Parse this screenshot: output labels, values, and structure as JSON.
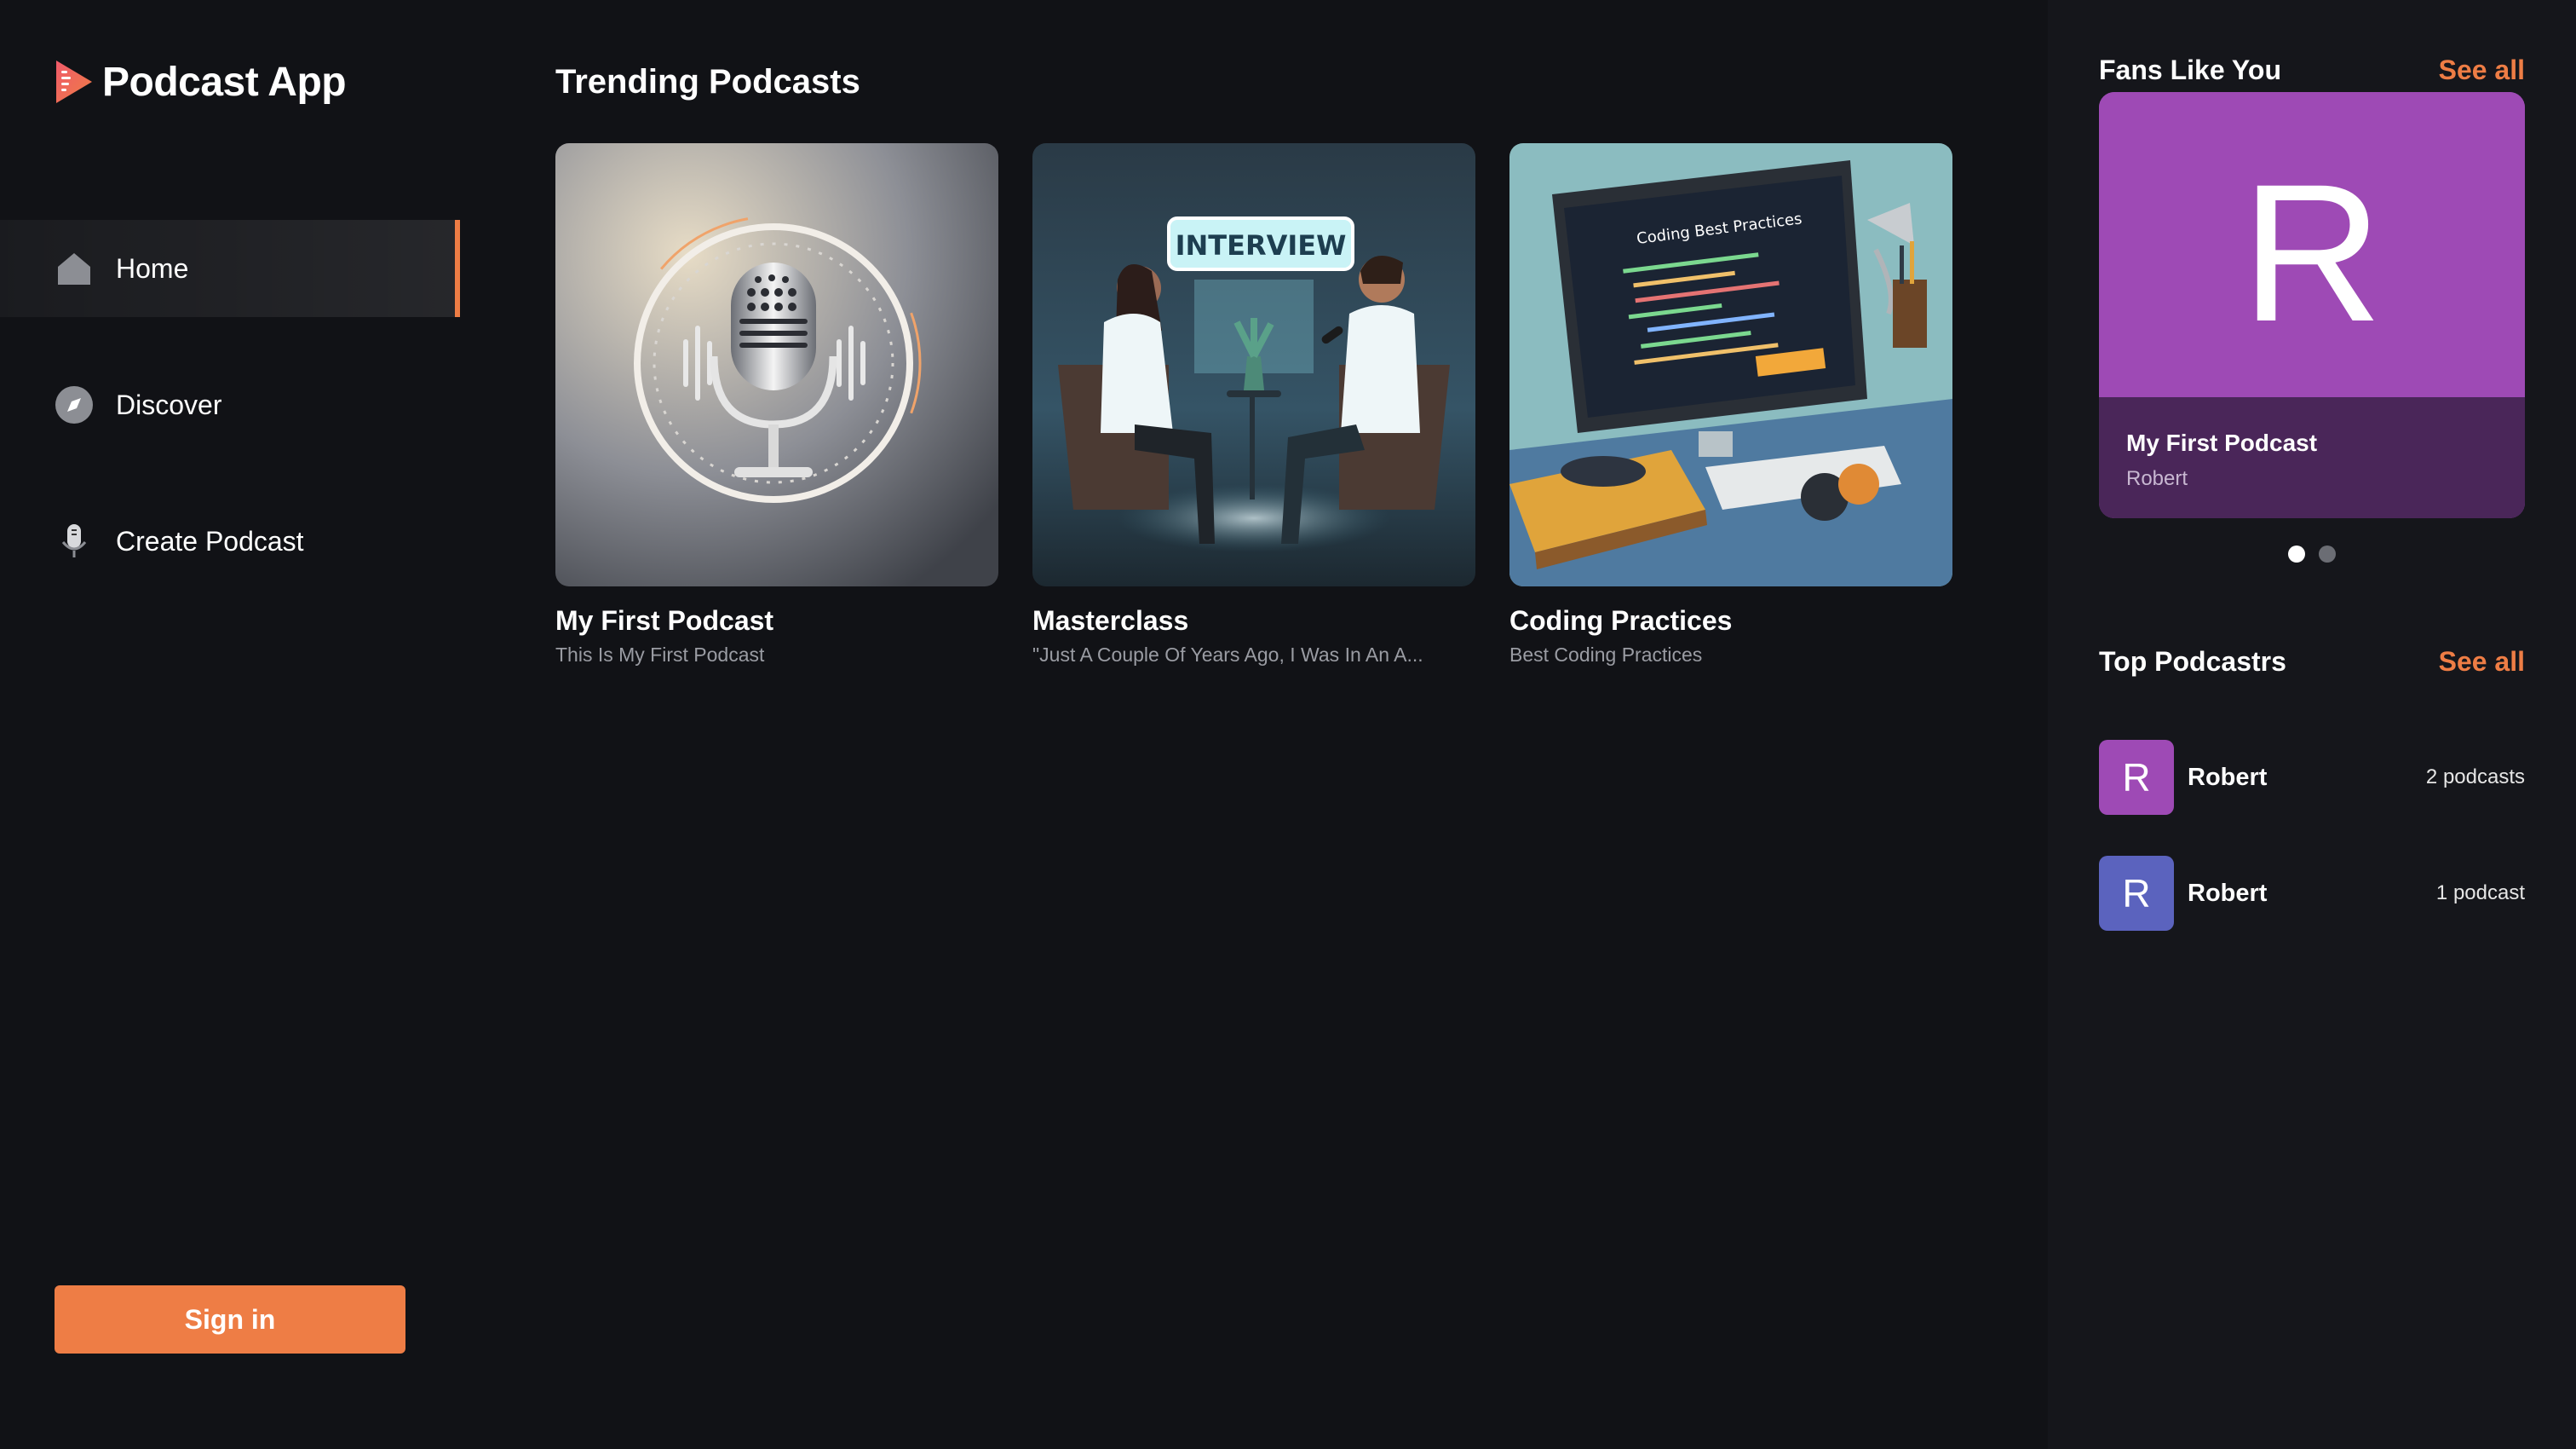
{
  "app": {
    "name": "Podcast App"
  },
  "sidebar": {
    "items": [
      {
        "label": "Home",
        "icon": "home-icon",
        "active": true
      },
      {
        "label": "Discover",
        "icon": "compass-icon",
        "active": false
      },
      {
        "label": "Create Podcast",
        "icon": "microphone-icon",
        "active": false
      }
    ],
    "signin_label": "Sign in"
  },
  "main": {
    "title": "Trending Podcasts",
    "cards": [
      {
        "title": "My First Podcast",
        "subtitle": "This Is My First Podcast",
        "art": "microphone-artwork"
      },
      {
        "title": "Masterclass",
        "subtitle": "\"Just A Couple Of Years Ago, I Was In An A...",
        "art": "interview-artwork",
        "art_text": "INTERVIEW"
      },
      {
        "title": "Coding Practices",
        "subtitle": "Best Coding Practices",
        "art": "coding-desk-artwork",
        "art_text": "Coding Best Practices"
      }
    ]
  },
  "right_panel": {
    "fans": {
      "title": "Fans Like You",
      "see_all": "See all",
      "card": {
        "letter": "R",
        "title": "My First Podcast",
        "author": "Robert",
        "color": "#9e4ab5",
        "footer_color": "#4a2659"
      },
      "carousel": {
        "pages": 2,
        "current": 1
      }
    },
    "top": {
      "title": "Top Podcastrs",
      "see_all": "See all",
      "items": [
        {
          "letter": "R",
          "name": "Robert",
          "count": "2 podcasts",
          "color": "#9e4ab5"
        },
        {
          "letter": "R",
          "name": "Robert",
          "count": "1 podcast",
          "color": "#5b63be"
        }
      ]
    }
  },
  "colors": {
    "accent": "#ee7d45",
    "background": "#111216",
    "panel": "#15161b"
  }
}
